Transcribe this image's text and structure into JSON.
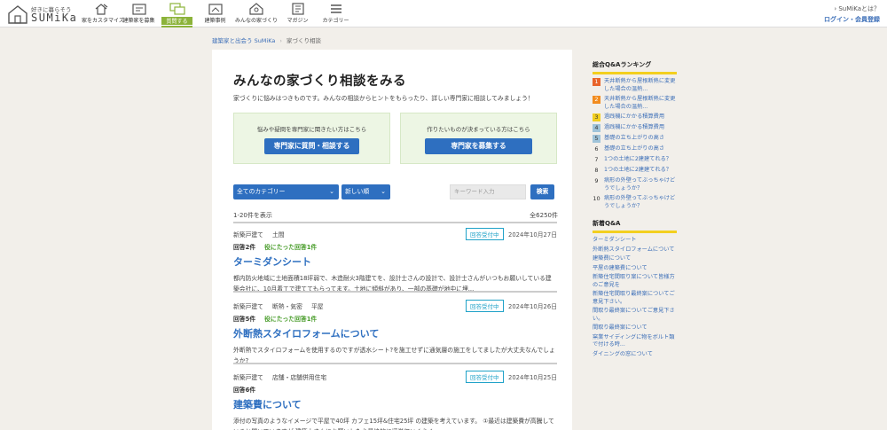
{
  "header": {
    "logo_tagline": "好きに暮らそう",
    "logo_brand": "SUMiKa",
    "nav": [
      {
        "label": "家をカスタマイズ",
        "icon": "customize-icon"
      },
      {
        "label": "建築家を募集",
        "icon": "recruit-icon"
      },
      {
        "label": "質問する",
        "icon": "question-icon",
        "active": true
      },
      {
        "label": "建築事例",
        "icon": "house-case-icon"
      },
      {
        "label": "みんなの家づくり",
        "icon": "people-icon"
      },
      {
        "label": "マガジン",
        "icon": "magazine-icon"
      },
      {
        "label": "カテゴリー",
        "icon": "category-icon"
      }
    ],
    "about": "› SuMiKaとは？",
    "login": "ログイン・会員登録"
  },
  "breadcrumb": {
    "home": "建築家と出会う SuMiKa",
    "separator": "›",
    "current": "家づくり相談"
  },
  "main": {
    "title": "みんなの家づくり相談をみる",
    "lead": "家づくりに悩みはつきものです。みんなの相談からヒントをもらったり、詳しい専門家に相談してみましょう！",
    "cta_a": {
      "text": "悩みや疑問を専門家に聞きたい方はこちら",
      "button": "専門家に質問・相談する"
    },
    "cta_b": {
      "text": "作りたいものが決まっている方はこちら",
      "button": "専門家を募集する"
    },
    "filters": {
      "category": "全てのカテゴリー",
      "sort": "新しい順",
      "keyword_placeholder": "キーワード入力",
      "search_button": "検索"
    },
    "range": "1-20件を表示",
    "total": "全6250件",
    "questions": [
      {
        "cats": [
          "新築戸建て",
          "土間"
        ],
        "status": "回答受付中",
        "date": "2024年10月27日",
        "answers": "回答2件",
        "helpful": "役にたった回答1件",
        "title": "ターミダンシート",
        "body": "都内防火地域に土地面積18坪弱で、木造耐火3階建てを、設計士さんの設計で、設計士さんがいつもお願いしている建築会社に、10月着工で建ててもらってます。土地に傾斜があり、一部の基礎が地中に埋..."
      },
      {
        "cats": [
          "新築戸建て",
          "断熱・気密",
          "平屋"
        ],
        "status": "回答受付中",
        "date": "2024年10月26日",
        "answers": "回答5件",
        "helpful": "役にたった回答1件",
        "title": "外断熱スタイロフォームについて",
        "body": "外断熱でスタイロフォームを使用するのですが透水シート?を施工せずに通気層の施工をしてましたが大丈夫なんでしょうか?"
      },
      {
        "cats": [
          "新築戸建て",
          "店舗・店舗併用住宅"
        ],
        "status": "回答受付中",
        "date": "2024年10月25日",
        "answers": "回答6件",
        "helpful": "",
        "title": "建築費について",
        "body": "添付の写真のようなイメージで平屋で40坪 カフェ15坪&住宅25坪 の建築を考えています。 ①最近は建築費が高騰していると聞いていますが 建築士さんにお願いしたら最終的に坪単価いくらく..."
      }
    ]
  },
  "sidebar": {
    "ranking_title": "総合Q&Aランキング",
    "ranking": [
      {
        "num": "1",
        "title": "天井断熱から屋根断熱に変更した場合の温熱..."
      },
      {
        "num": "2",
        "title": "天井断熱から屋根断熱に変更した場合の温熱..."
      },
      {
        "num": "3",
        "title": "過践機にかかる積算費用"
      },
      {
        "num": "4",
        "title": "過践機にかかる積算費用"
      },
      {
        "num": "5",
        "title": "基礎の立ち上がりの高さ"
      },
      {
        "num": "6",
        "title": "基礎の立ち上がりの高さ"
      },
      {
        "num": "7",
        "title": "1つの土地に2建建てれる？"
      },
      {
        "num": "8",
        "title": "1つの土地に2建建てれる？"
      },
      {
        "num": "9",
        "title": "病形の外壁ってぶっちゃけどうでしょうか？"
      },
      {
        "num": "10",
        "title": "病形の外壁ってぶっちゃけどうでしょうか？"
      }
    ],
    "new_title": "新着Q&A",
    "new_items": [
      "ターミダンシート",
      "外断熱スタイロフォームについて",
      "建築費について",
      "平屋の建築費について",
      "新築住宅間取り案について皆様方のご意見を",
      "新築住宅間取り最終案についてご意見下さい。",
      "間取り最終案についてご意見下さい。",
      "間取り最終案について",
      "窯業サイディングに物をボルト類で付ける時...",
      "ダイニングの窓について"
    ]
  }
}
